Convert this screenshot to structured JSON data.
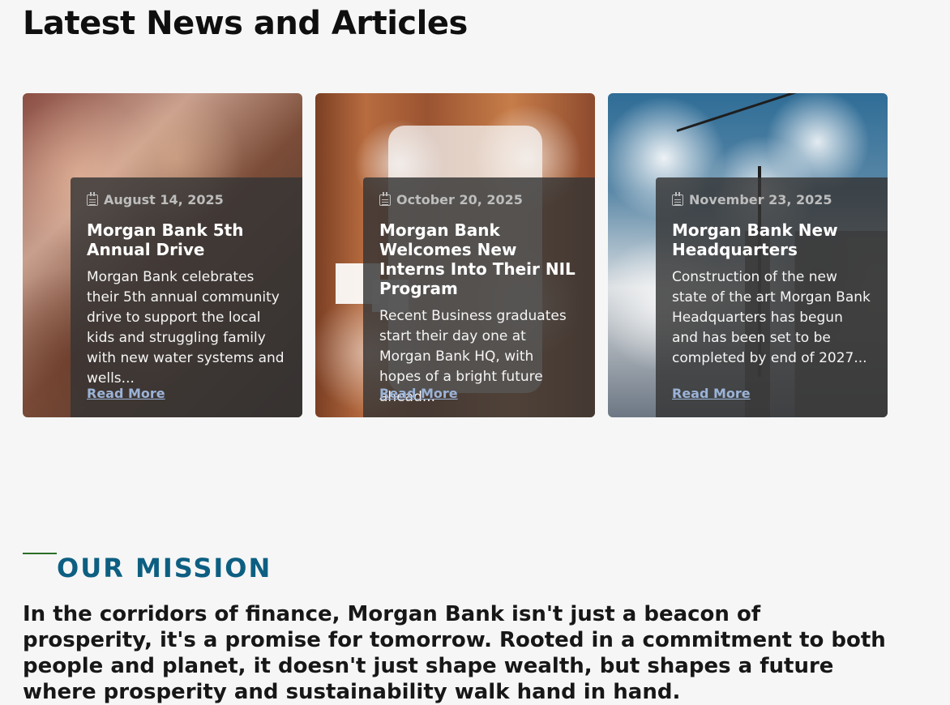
{
  "news": {
    "title": "Latest News and Articles",
    "cards": [
      {
        "date": "August 14, 2025",
        "title": "Morgan Bank 5th Annual Drive",
        "summary": "Morgan Bank celebrates their 5th annual community drive to support the local kids and struggling family with new water systems and wells...",
        "cta": "Read More",
        "icon": "calendar-icon",
        "image": "children-smiling-photo"
      },
      {
        "date": "October 20, 2025",
        "title": "Morgan Bank Welcomes New Interns Into Their NIL Program",
        "summary": "Recent Business graduates start their day one at Morgan Bank HQ, with hopes of a bright future ahead...",
        "cta": "Read More",
        "icon": "calendar-icon",
        "image": "office-meeting-photo"
      },
      {
        "date": "November 23, 2025",
        "title": "Morgan Bank New Headquarters",
        "summary": "Construction of the new state of the art Morgan Bank Headquarters has begun and has been set to be completed by end of 2027...",
        "cta": "Read More",
        "icon": "calendar-icon",
        "image": "construction-site-photo"
      }
    ]
  },
  "mission": {
    "label": "OUR MISSION",
    "text": "In the corridors of finance, Morgan Bank isn't just a beacon of prosperity, it's a promise for tomorrow. Rooted in a commitment to both people and planet, it doesn't just shape wealth, but shapes a future where prosperity and sustainability walk hand in hand."
  },
  "colors": {
    "background": "#f6f6f6",
    "heading": "#0f0f0f",
    "mission_label": "#0d5f82",
    "mission_rule": "#2c6e28",
    "overlay": "#353535",
    "read_more": "#9bb3d7"
  }
}
